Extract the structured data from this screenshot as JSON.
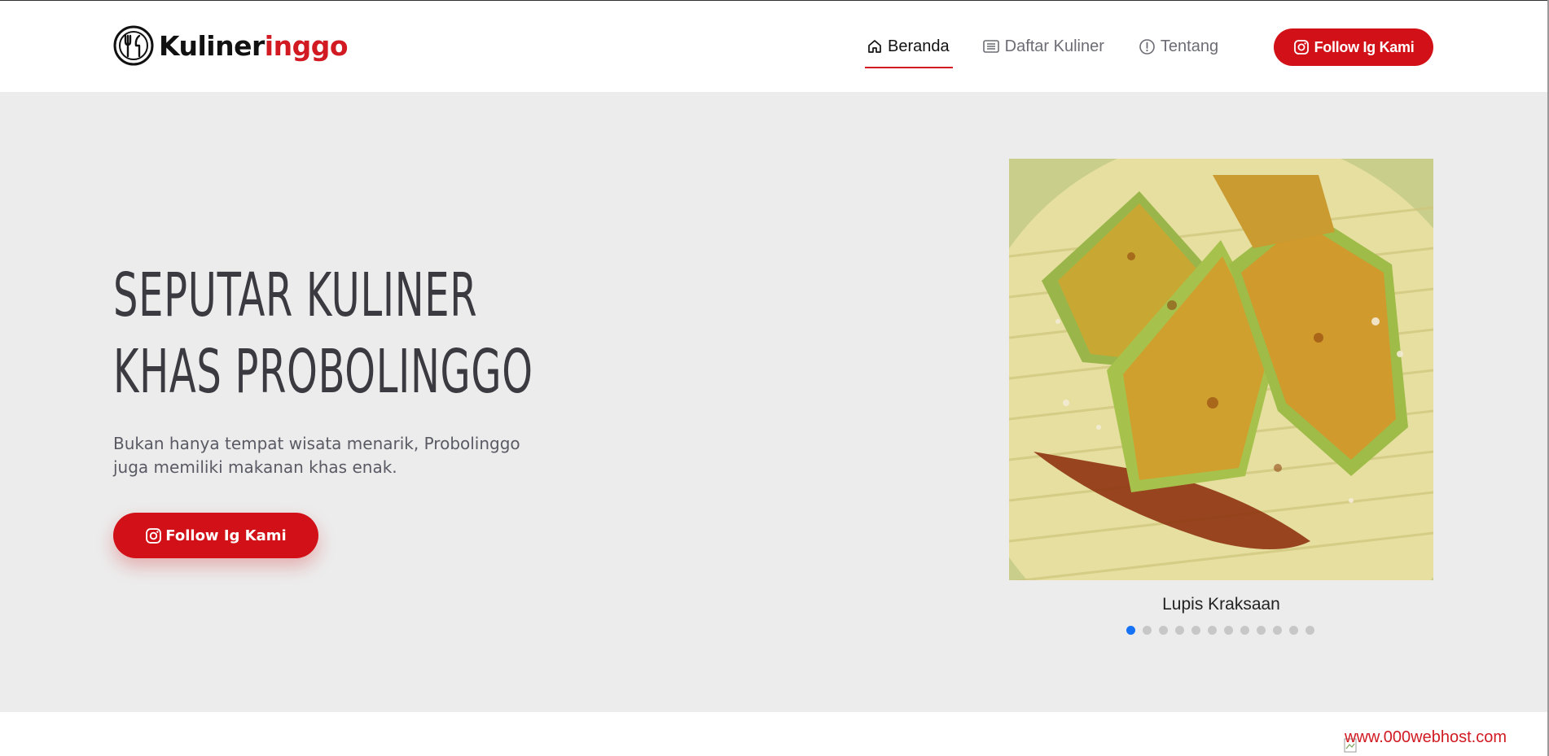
{
  "brand": {
    "name_part1": "Kuliner",
    "name_part2": "inggo",
    "logo_icon": "restaurant-logo-icon"
  },
  "nav": {
    "items": [
      {
        "label": "Beranda",
        "icon": "home-icon",
        "active": true
      },
      {
        "label": "Daftar Kuliner",
        "icon": "list-icon",
        "active": false
      },
      {
        "label": "Tentang",
        "icon": "info-icon",
        "active": false
      }
    ],
    "cta_label": "Follow Ig Kami",
    "cta_icon": "instagram-icon"
  },
  "hero": {
    "title_line1": "SEPUTAR KULINER",
    "title_line2": "KHAS PROBOLINGGO",
    "description": "Bukan hanya tempat wisata menarik, Probolinggo juga memiliki makanan khas enak.",
    "cta_label": "Follow Ig Kami",
    "cta_icon": "instagram-icon"
  },
  "carousel": {
    "caption": "Lupis Kraksaan",
    "slide_count": 12,
    "active_index": 0
  },
  "footer": {
    "host_text": "www.000webhost.com"
  },
  "colors": {
    "accent": "#d11117",
    "hero_bg": "#ececec",
    "dot_active": "#1673f5",
    "dot_inactive": "#c7c7c7"
  }
}
